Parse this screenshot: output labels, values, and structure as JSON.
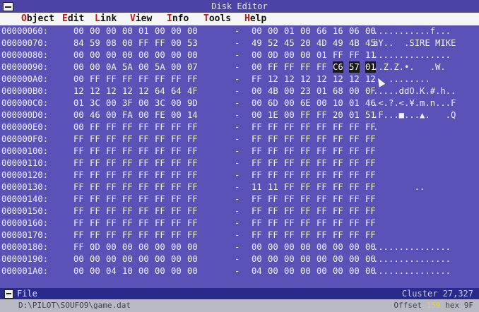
{
  "window": {
    "title": "Disk Editor"
  },
  "menu": [
    {
      "hot": "O",
      "rest": "bject"
    },
    {
      "hot": "E",
      "rest": "dit"
    },
    {
      "hot": "L",
      "rest": "ink"
    },
    {
      "hot": "V",
      "rest": "iew"
    },
    {
      "hot": "I",
      "rest": "nfo"
    },
    {
      "hot": "T",
      "rest": "ools"
    },
    {
      "hot": "H",
      "rest": "elp"
    }
  ],
  "rows": [
    {
      "addr": "00000060:",
      "bytes": [
        "00",
        "00",
        "00",
        "00",
        "01",
        "00",
        "00",
        "00",
        "00",
        "00",
        "01",
        "00",
        "66",
        "16",
        "06",
        "00"
      ],
      "ascii": "...........f..."
    },
    {
      "addr": "00000070:",
      "bytes": [
        "84",
        "59",
        "08",
        "00",
        "FF",
        "FF",
        "00",
        "53",
        "49",
        "52",
        "45",
        "20",
        "4D",
        "49",
        "4B",
        "45"
      ],
      "ascii": "äY..  .SIRE MIKE"
    },
    {
      "addr": "00000080:",
      "bytes": [
        "00",
        "00",
        "00",
        "00",
        "00",
        "00",
        "00",
        "00",
        "00",
        "0D",
        "00",
        "00",
        "01",
        "FF",
        "FF",
        "11"
      ],
      "ascii": "..............."
    },
    {
      "addr": "00000090:",
      "bytes": [
        "00",
        "00",
        "0A",
        "5A",
        "00",
        "5A",
        "00",
        "07",
        "00",
        "FF",
        "FF",
        "FF",
        "FF",
        "C6",
        "57",
        "01"
      ],
      "ascii": "..Z.Z.•.   .W.",
      "selected": [
        13,
        14,
        15
      ]
    },
    {
      "addr": "000000A0:",
      "bytes": [
        "00",
        "FF",
        "FF",
        "FF",
        "FF",
        "FF",
        "FF",
        "FF",
        "FF",
        "12",
        "12",
        "12",
        "12",
        "12",
        "12",
        "12"
      ],
      "ascii": "   ........"
    },
    {
      "addr": "000000B0:",
      "bytes": [
        "12",
        "12",
        "12",
        "12",
        "12",
        "64",
        "64",
        "4F",
        "00",
        "4B",
        "00",
        "23",
        "01",
        "68",
        "00",
        "0F"
      ],
      "ascii": ".....ddO.K.#.h.."
    },
    {
      "addr": "000000C0:",
      "bytes": [
        "01",
        "3C",
        "00",
        "3F",
        "00",
        "3C",
        "00",
        "9D",
        "00",
        "6D",
        "00",
        "6E",
        "00",
        "10",
        "01",
        "46"
      ],
      "ascii": ".<.?.<.¥.m.n...F"
    },
    {
      "addr": "000000D0:",
      "bytes": [
        "00",
        "46",
        "00",
        "FA",
        "00",
        "FE",
        "00",
        "14",
        "00",
        "1E",
        "00",
        "FF",
        "FF",
        "20",
        "01",
        "51"
      ],
      "ascii": ".F...■...▲.   .Q"
    },
    {
      "addr": "000000E0:",
      "bytes": [
        "00",
        "FF",
        "FF",
        "FF",
        "FF",
        "FF",
        "FF",
        "FF",
        "FF",
        "FF",
        "FF",
        "FF",
        "FF",
        "FF",
        "FF",
        "FF"
      ],
      "ascii": "."
    },
    {
      "addr": "000000F0:",
      "bytes": [
        "FF",
        "FF",
        "FF",
        "FF",
        "FF",
        "FF",
        "FF",
        "FF",
        "FF",
        "FF",
        "FF",
        "FF",
        "FF",
        "FF",
        "FF",
        "FF"
      ],
      "ascii": ""
    },
    {
      "addr": "00000100:",
      "bytes": [
        "FF",
        "FF",
        "FF",
        "FF",
        "FF",
        "FF",
        "FF",
        "FF",
        "FF",
        "FF",
        "FF",
        "FF",
        "FF",
        "FF",
        "FF",
        "FF"
      ],
      "ascii": ""
    },
    {
      "addr": "00000110:",
      "bytes": [
        "FF",
        "FF",
        "FF",
        "FF",
        "FF",
        "FF",
        "FF",
        "FF",
        "FF",
        "FF",
        "FF",
        "FF",
        "FF",
        "FF",
        "FF",
        "FF"
      ],
      "ascii": ""
    },
    {
      "addr": "00000120:",
      "bytes": [
        "FF",
        "FF",
        "FF",
        "FF",
        "FF",
        "FF",
        "FF",
        "FF",
        "FF",
        "FF",
        "FF",
        "FF",
        "FF",
        "FF",
        "FF",
        "FF"
      ],
      "ascii": ""
    },
    {
      "addr": "00000130:",
      "bytes": [
        "FF",
        "FF",
        "FF",
        "FF",
        "FF",
        "FF",
        "FF",
        "FF",
        "11",
        "11",
        "FF",
        "FF",
        "FF",
        "FF",
        "FF",
        "FF"
      ],
      "ascii": "        .."
    },
    {
      "addr": "00000140:",
      "bytes": [
        "FF",
        "FF",
        "FF",
        "FF",
        "FF",
        "FF",
        "FF",
        "FF",
        "FF",
        "FF",
        "FF",
        "FF",
        "FF",
        "FF",
        "FF",
        "FF"
      ],
      "ascii": ""
    },
    {
      "addr": "00000150:",
      "bytes": [
        "FF",
        "FF",
        "FF",
        "FF",
        "FF",
        "FF",
        "FF",
        "FF",
        "FF",
        "FF",
        "FF",
        "FF",
        "FF",
        "FF",
        "FF",
        "FF"
      ],
      "ascii": ""
    },
    {
      "addr": "00000160:",
      "bytes": [
        "FF",
        "FF",
        "FF",
        "FF",
        "FF",
        "FF",
        "FF",
        "FF",
        "FF",
        "FF",
        "FF",
        "FF",
        "FF",
        "FF",
        "FF",
        "FF"
      ],
      "ascii": ""
    },
    {
      "addr": "00000170:",
      "bytes": [
        "FF",
        "FF",
        "FF",
        "FF",
        "FF",
        "FF",
        "FF",
        "FF",
        "FF",
        "FF",
        "FF",
        "FF",
        "FF",
        "FF",
        "FF",
        "FF"
      ],
      "ascii": ""
    },
    {
      "addr": "00000180:",
      "bytes": [
        "FF",
        "0D",
        "00",
        "00",
        "00",
        "00",
        "00",
        "00",
        "00",
        "00",
        "00",
        "00",
        "00",
        "00",
        "00",
        "00"
      ],
      "ascii": "..............."
    },
    {
      "addr": "00000190:",
      "bytes": [
        "00",
        "00",
        "00",
        "00",
        "00",
        "00",
        "00",
        "00",
        "00",
        "00",
        "00",
        "00",
        "00",
        "00",
        "00",
        "00"
      ],
      "ascii": "..............."
    },
    {
      "addr": "000001A0:",
      "bytes": [
        "00",
        "00",
        "04",
        "10",
        "00",
        "00",
        "00",
        "00",
        "04",
        "00",
        "00",
        "00",
        "00",
        "00",
        "00",
        "00"
      ],
      "ascii": "..............."
    }
  ],
  "status": {
    "object": "File",
    "cluster": "Cluster 27,327",
    "path": "D:\\PILOT\\SOUFO9\\game.dat",
    "offset_label": "Offset",
    "offset_value": "159",
    "hex_label": "hex 9F"
  },
  "colors": {
    "background": "#5a52b6",
    "menubar": "#f5f5f5",
    "hotkey": "#c01818",
    "selection": "#1a1a1a"
  }
}
